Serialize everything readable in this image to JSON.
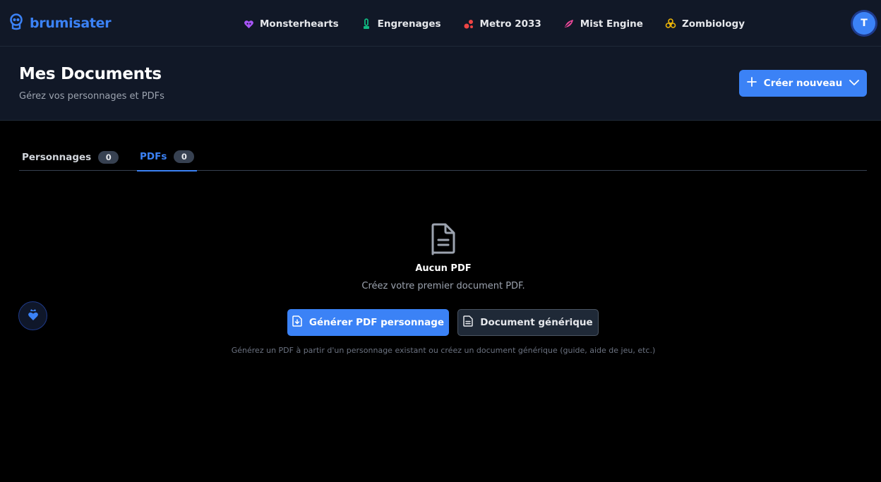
{
  "brand": {
    "name": "brumisater"
  },
  "nav": {
    "items": [
      {
        "label": "Monsterhearts",
        "icon": "monsterhearts-icon",
        "color": "#a855f7"
      },
      {
        "label": "Engrenages",
        "icon": "engrenages-icon",
        "color": "#10b981"
      },
      {
        "label": "Metro 2033",
        "icon": "metro-icon",
        "color": "#ef4444"
      },
      {
        "label": "Mist Engine",
        "icon": "mist-engine-icon",
        "color": "#ec4899"
      },
      {
        "label": "Zombiology",
        "icon": "biohazard-icon",
        "color": "#eab308"
      }
    ]
  },
  "user": {
    "initial": "T"
  },
  "header": {
    "title": "Mes Documents",
    "subtitle": "Gérez vos personnages et PDFs",
    "create_label": "Créer nouveau"
  },
  "tabs": [
    {
      "label": "Personnages",
      "count": "0",
      "active": false
    },
    {
      "label": "PDFs",
      "count": "0",
      "active": true
    }
  ],
  "empty": {
    "title": "Aucun PDF",
    "description": "Créez votre premier document PDF.",
    "primary_label": "Générer PDF personnage",
    "secondary_label": "Document générique",
    "hint": "Générez un PDF à partir d'un personnage existant ou créez un document générique (guide, aide de jeu, etc.)"
  },
  "colors": {
    "accent": "#3b82f6",
    "navbar_bg": "#111827",
    "page_bg": "#000000"
  }
}
